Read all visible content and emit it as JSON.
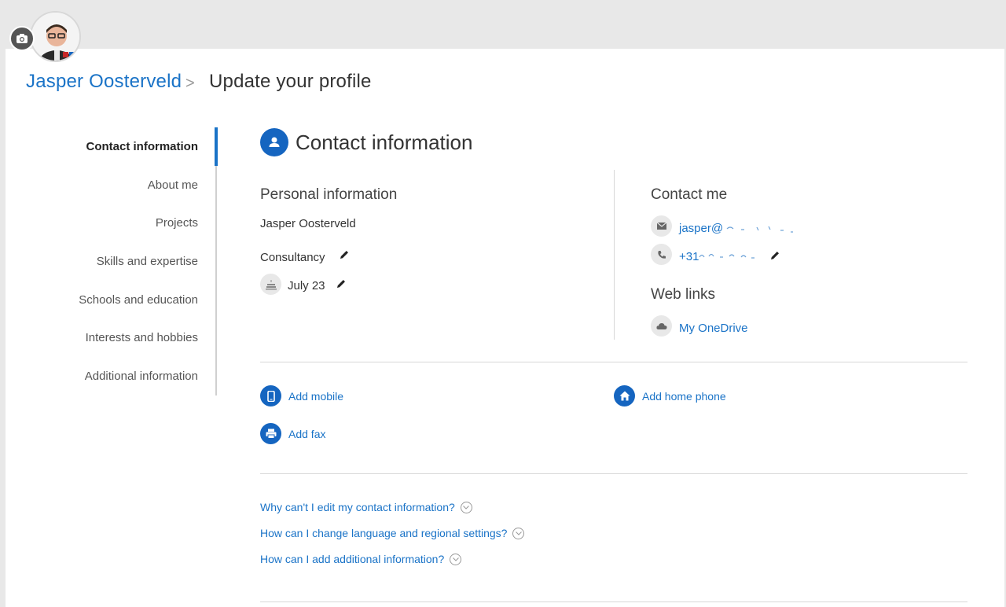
{
  "breadcrumb": {
    "user_name": "Jasper Oosterveld",
    "separator": ">",
    "page_title": "Update your profile"
  },
  "nav": {
    "items": [
      {
        "label": "Contact information",
        "active": true
      },
      {
        "label": "About me",
        "active": false
      },
      {
        "label": "Projects",
        "active": false
      },
      {
        "label": "Skills and expertise",
        "active": false
      },
      {
        "label": "Schools and education",
        "active": false
      },
      {
        "label": "Interests and hobbies",
        "active": false
      },
      {
        "label": "Additional information",
        "active": false
      }
    ]
  },
  "section": {
    "title": "Contact information",
    "icon": "person-icon"
  },
  "personal": {
    "heading": "Personal information",
    "name": "Jasper Oosterveld",
    "department": "Consultancy",
    "birthday": "July 23"
  },
  "contact": {
    "heading": "Contact me",
    "email": "jasper@",
    "phone": "+31",
    "web_heading": "Web links",
    "onedrive": "My OneDrive"
  },
  "add": {
    "mobile": "Add mobile",
    "home_phone": "Add home phone",
    "fax": "Add fax"
  },
  "faq": [
    "Why can't I edit my contact information?",
    "How can I change language and regional settings?",
    "How can I add additional information?"
  ],
  "colors": {
    "accent": "#1565c0",
    "link": "#1a73c7",
    "page_bg": "#e8e8e8"
  }
}
